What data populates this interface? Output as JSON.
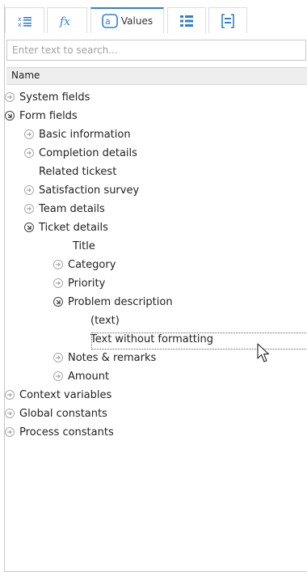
{
  "tabs": [
    {
      "name": "fields-tab",
      "label": ""
    },
    {
      "name": "functions-tab",
      "label": ""
    },
    {
      "name": "values-tab",
      "label": "Values"
    },
    {
      "name": "list-tab",
      "label": ""
    },
    {
      "name": "bracket-tab",
      "label": ""
    }
  ],
  "search": {
    "placeholder": "Enter text to search...",
    "value": ""
  },
  "column_header": "Name",
  "tree": {
    "system_fields": "System fields",
    "form_fields": "Form fields",
    "basic_information": "Basic information",
    "completion_details": "Completion details",
    "related_tickest": "Related tickest",
    "satisfaction_survey": "Satisfaction survey",
    "team_details": "Team details",
    "ticket_details": "Ticket details",
    "title": "Title",
    "category": "Category",
    "priority": "Priority",
    "problem_description": "Problem description",
    "text": "(text)",
    "text_without_formatting": "Text without formatting",
    "notes_remarks": "Notes & remarks",
    "amount": "Amount",
    "context_variables": "Context variables",
    "global_constants": "Global constants",
    "process_constants": "Process constants"
  },
  "colors": {
    "accent": "#2f7fd7",
    "header_bg": "#eeeeee",
    "border": "#c8c8c8"
  }
}
